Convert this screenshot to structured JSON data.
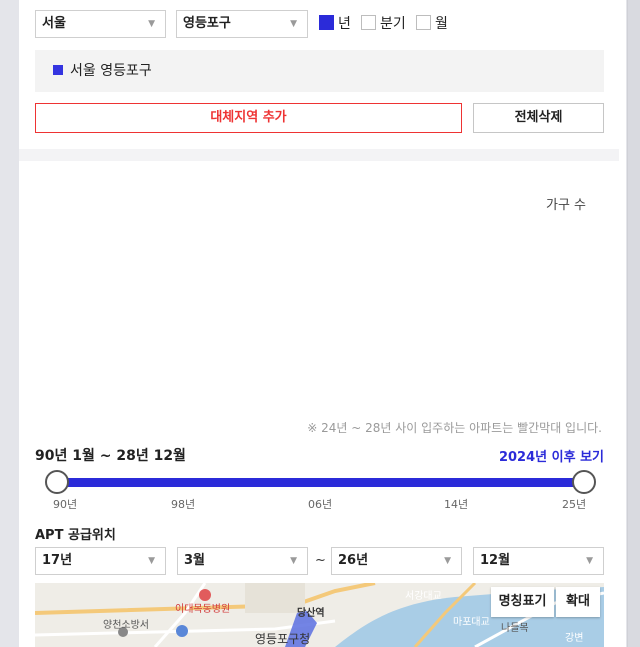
{
  "filters": {
    "city": "서울",
    "district": "영등포구",
    "period_options": [
      {
        "label": "년",
        "checked": true
      },
      {
        "label": "분기",
        "checked": false
      },
      {
        "label": "월",
        "checked": false
      }
    ]
  },
  "region_tag": "서울 영등포구",
  "buttons": {
    "add_alt_region": "대체지역 추가",
    "delete_all": "전체삭제"
  },
  "chart": {
    "y_label": "가구 수",
    "note": "※ 24년 ~ 28년 사이 입주하는 아파트는 빨간막대 입니다."
  },
  "range": {
    "title": "90년 1월 ~ 28년 12월",
    "after_link": "2024년 이후 보기",
    "slider_min_fraction": 0.0,
    "slider_max_fraction": 1.0,
    "ticks": [
      "90년",
      "98년",
      "06년",
      "14년",
      "25년"
    ]
  },
  "apt_supply": {
    "title": "APT 공급위치",
    "from_year": "17년",
    "from_month": "3월",
    "separator": "~",
    "to_year": "26년",
    "to_month": "12월"
  },
  "map": {
    "name_toggle": "명칭표기",
    "zoom": "확대",
    "labels": {
      "hospital": "이대목동병원",
      "fire_station": "양천소방서",
      "station": "당산역",
      "district_office": "영등포구청",
      "bridge": "서강대교",
      "mapo_bridge": "마포대교",
      "nadeul": "나들목",
      "river": "강변"
    }
  },
  "colors": {
    "accent": "#2b2bd9",
    "danger": "#e33333"
  }
}
